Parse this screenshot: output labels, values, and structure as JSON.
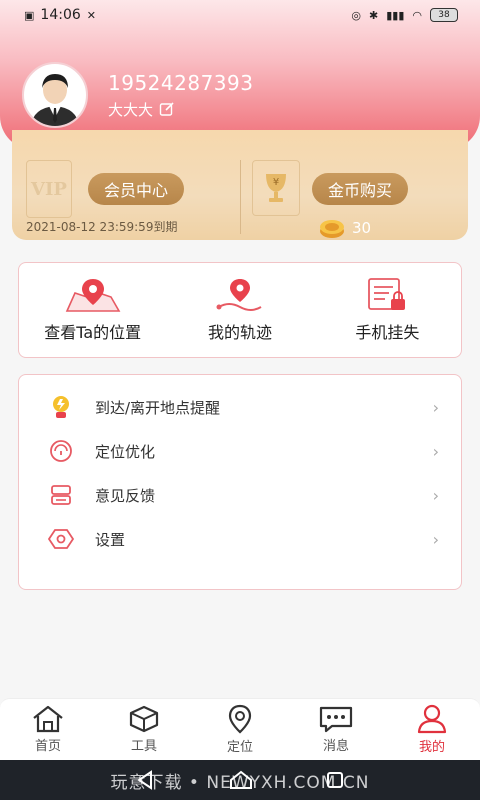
{
  "status_bar": {
    "time": "14:06",
    "battery": "38"
  },
  "profile": {
    "phone": "19524287393",
    "nickname": "大大大"
  },
  "vip": {
    "badge_text": "VIP",
    "member_button": "会员中心",
    "expire_text": "2021-08-12 23:59:59到期",
    "coin_button": "金币购买",
    "coin_count": "30"
  },
  "actions": [
    {
      "label": "查看Ta的位置"
    },
    {
      "label": "我的轨迹"
    },
    {
      "label": "手机挂失"
    }
  ],
  "menu": [
    {
      "label": "到达/离开地点提醒"
    },
    {
      "label": "定位优化"
    },
    {
      "label": "意见反馈"
    },
    {
      "label": "设置"
    }
  ],
  "nav": [
    {
      "label": "首页"
    },
    {
      "label": "工具"
    },
    {
      "label": "定位"
    },
    {
      "label": "消息"
    },
    {
      "label": "我的"
    }
  ],
  "watermark": "玩意下载 • NEWYXH.COM.CN",
  "colors": {
    "accent": "#e0313d",
    "gold": "#b7864a",
    "card_border": "#f2c4c7"
  }
}
